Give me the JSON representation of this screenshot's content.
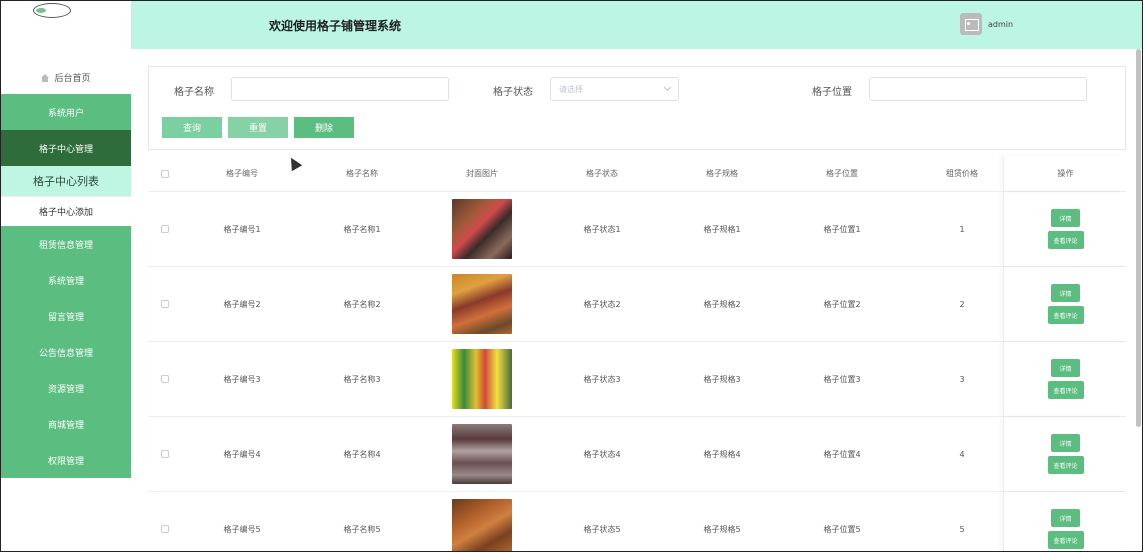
{
  "header": {
    "title": "欢迎使用格子铺管理系统",
    "username": "admin"
  },
  "sidebar": {
    "home": "后台首页",
    "items": [
      {
        "label": "系统用户"
      },
      {
        "label": "格子中心管理"
      },
      {
        "label": "格子中心列表"
      },
      {
        "label": "格子中心添加"
      },
      {
        "label": "租赁信息管理"
      },
      {
        "label": "系统管理"
      },
      {
        "label": "留言管理"
      },
      {
        "label": "公告信息管理"
      },
      {
        "label": "资源管理"
      },
      {
        "label": "商城管理"
      },
      {
        "label": "权限管理"
      }
    ]
  },
  "search": {
    "name_label": "格子名称",
    "status_label": "格子状态",
    "status_placeholder": "请选择",
    "location_label": "格子位置",
    "query_btn": "查询",
    "reset_btn": "重置",
    "delete_btn": "删除"
  },
  "table": {
    "columns": [
      "格子编号",
      "格子名称",
      "封面图片",
      "格子状态",
      "格子规格",
      "格子位置",
      "租赁价格",
      "操作"
    ],
    "rows": [
      {
        "id": "格子编号1",
        "name": "格子名称1",
        "status": "格子状态1",
        "spec": "格子规格1",
        "location": "格子位置1",
        "price": "1"
      },
      {
        "id": "格子编号2",
        "name": "格子名称2",
        "status": "格子状态2",
        "spec": "格子规格2",
        "location": "格子位置2",
        "price": "2"
      },
      {
        "id": "格子编号3",
        "name": "格子名称3",
        "status": "格子状态3",
        "spec": "格子规格3",
        "location": "格子位置3",
        "price": "3"
      },
      {
        "id": "格子编号4",
        "name": "格子名称4",
        "status": "格子状态4",
        "spec": "格子规格4",
        "location": "格子位置4",
        "price": "4"
      },
      {
        "id": "格子编号5",
        "name": "格子名称5",
        "status": "格子状态5",
        "spec": "格子规格5",
        "location": "格子位置5",
        "price": "5"
      }
    ],
    "detail_btn": "详情",
    "comment_btn": "查看评论"
  },
  "colors": {
    "accent": "#5cbd80",
    "header_bg": "#bdf5e4",
    "menu_active": "#2f6c3c",
    "query_btn": "#7ccfa0",
    "reset_btn": "#86d1a6"
  }
}
